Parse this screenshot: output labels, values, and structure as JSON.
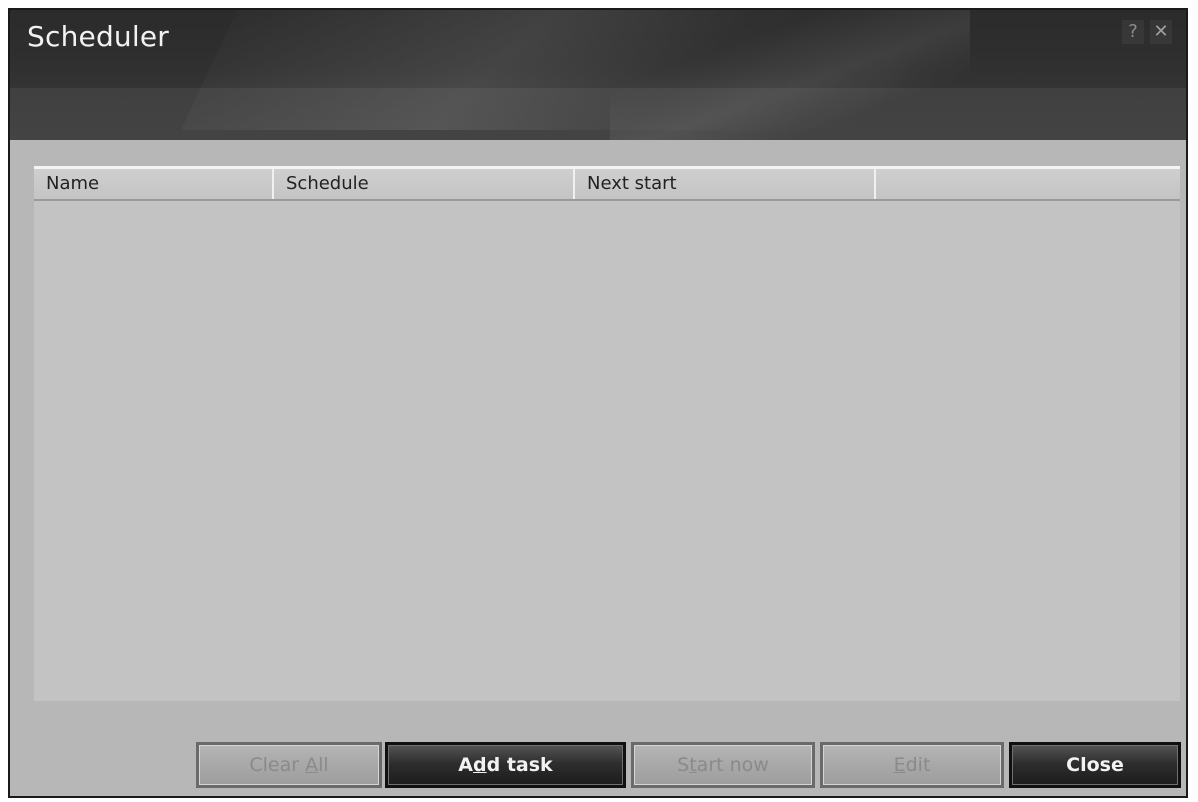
{
  "window": {
    "title": "Scheduler",
    "help_glyph": "?",
    "close_glyph": "✕"
  },
  "table": {
    "columns": [
      "Name",
      "Schedule",
      "Next start",
      ""
    ],
    "rows": []
  },
  "buttons": {
    "clear_all": {
      "pre": "Clear ",
      "mnemonic": "A",
      "post": "ll",
      "enabled": false
    },
    "add_task": {
      "pre": "A",
      "mnemonic": "d",
      "post": "d task",
      "enabled": true
    },
    "start_now": {
      "pre": "S",
      "mnemonic": "t",
      "post": "art now",
      "enabled": false
    },
    "edit": {
      "pre": "",
      "mnemonic": "E",
      "post": "dit",
      "enabled": false
    },
    "close": {
      "pre": "",
      "mnemonic": "",
      "post": "Close",
      "enabled": true
    }
  }
}
